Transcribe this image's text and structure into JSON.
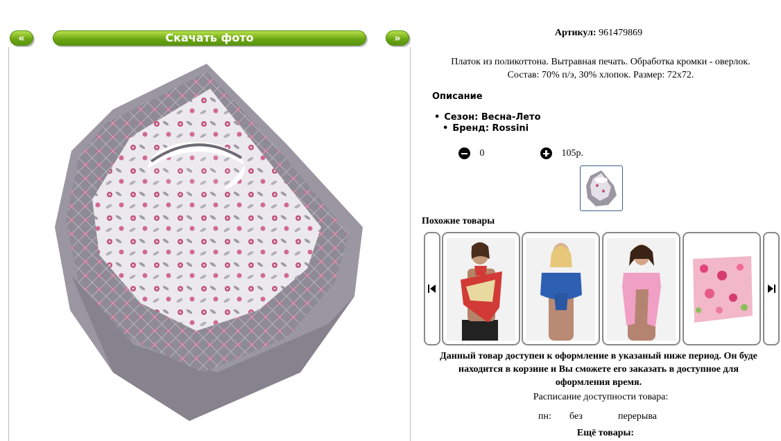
{
  "gallery": {
    "prev_label": "«",
    "next_label": "»",
    "download_label": "Скачать фото"
  },
  "product": {
    "article_label": "Артикул:",
    "article_value": "961479869",
    "description_line1": "Платок из поликоттона. Вытравная печать. Обработка кромки - оверлок.",
    "description_line2": "Состав: 70% п/э, 30% хлопок. Размер: 72х72.",
    "description_heading": "Описание",
    "props": [
      "Сезон: Весна-Лето",
      "Бренд: Rossini"
    ],
    "quantity": "0",
    "price": "105р."
  },
  "similar": {
    "title": "Похожие товары",
    "items": [
      {
        "name": "red-scarf-model"
      },
      {
        "name": "blue-scarf-model"
      },
      {
        "name": "pink-scarf-model"
      },
      {
        "name": "floral-pink-scarf"
      }
    ]
  },
  "availability": {
    "notice_line1": "Данный товар доступен к оформление в указаный ниже период. Он буде",
    "notice_line2": "находится в корзине и Вы сможете его заказать в доступное для",
    "notice_line3": "оформления время.",
    "schedule_title": "Расписание доступности товара:",
    "day": "пн:",
    "from": "без",
    "to": "перерыва"
  },
  "more_title": "Ещё товары:",
  "colors": {
    "button_green": "#6aa512",
    "scarf_gray": "#8e8a96",
    "scarf_pink": "#c0527a",
    "border": "#888888"
  }
}
